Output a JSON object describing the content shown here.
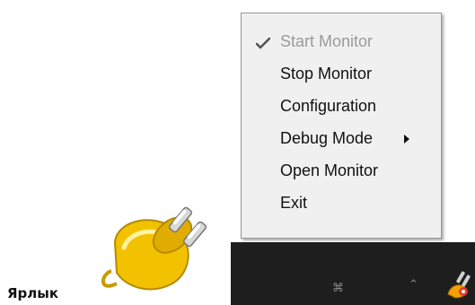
{
  "shortcut": {
    "label": "Ярлык",
    "icon": "plug-icon",
    "icon_color": "#f2c200"
  },
  "tray": {
    "background": "#1e1e1e",
    "glyphs": [
      "⌘",
      "⌃"
    ],
    "app_icon": "plug-tray-icon"
  },
  "context_menu": {
    "background": "#f0f0f0",
    "disabled_color": "#9a9a9a",
    "items": [
      {
        "label": "Start Monitor",
        "state": "disabled",
        "checked": true,
        "icon": "check-icon"
      },
      {
        "label": "Stop Monitor",
        "state": "enabled"
      },
      {
        "label": "Configuration",
        "state": "enabled"
      },
      {
        "label": "Debug Mode",
        "state": "enabled",
        "submenu": true,
        "icon": "submenu-arrow-icon"
      },
      {
        "label": "Open Monitor",
        "state": "enabled"
      },
      {
        "label": "Exit",
        "state": "enabled"
      }
    ]
  }
}
